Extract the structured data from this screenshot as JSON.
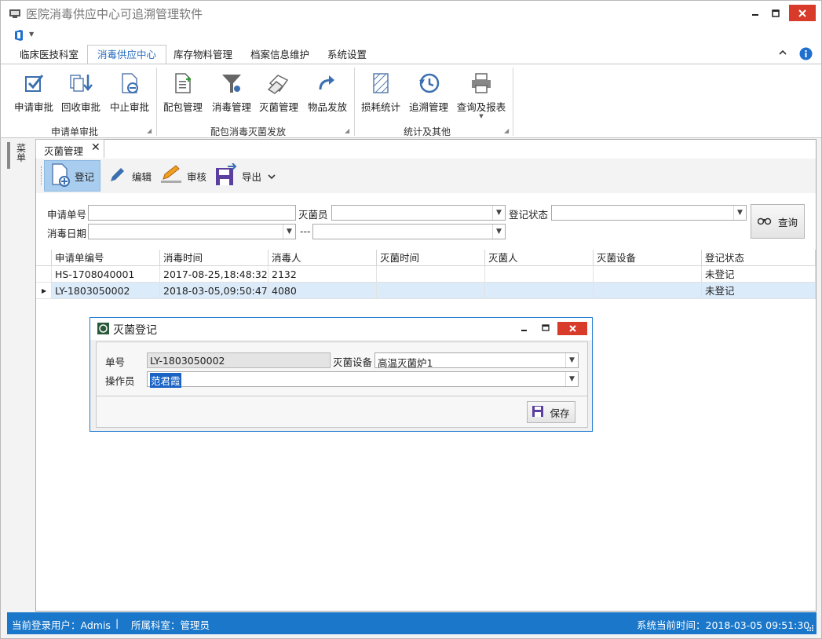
{
  "window": {
    "title": "医院消毒供应中心可追溯管理软件"
  },
  "ribbon_tabs": [
    "临床医技科室",
    "消毒供应中心",
    "库存物料管理",
    "档案信息维护",
    "系统设置"
  ],
  "ribbon_groups": [
    {
      "label": "申请单审批",
      "buttons": [
        "申请审批",
        "回收审批",
        "中止审批"
      ]
    },
    {
      "label": "配包消毒灭菌发放",
      "buttons": [
        "配包管理",
        "消毒管理",
        "灭菌管理",
        "物品发放"
      ]
    },
    {
      "label": "统计及其他",
      "buttons": [
        "损耗统计",
        "追溯管理",
        "查询及报表"
      ]
    }
  ],
  "sidebar": {
    "label": "菜单"
  },
  "doc_tab": {
    "label": "灭菌管理"
  },
  "toolbar": {
    "register": "登记",
    "edit": "编辑",
    "audit": "审核",
    "export": "导出"
  },
  "filter": {
    "request_no_label": "申请单号",
    "request_no_value": "",
    "sterilizer_label": "灭菌员",
    "sterilizer_value": "",
    "status_label": "登记状态",
    "status_value": "",
    "date_label": "消毒日期",
    "date_from": "",
    "date_sep": "---",
    "date_to": "",
    "query_button": "查询"
  },
  "grid": {
    "columns": [
      "申请单编号",
      "消毒时间",
      "消毒人",
      "灭菌时间",
      "灭菌人",
      "灭菌设备",
      "登记状态"
    ],
    "rows": [
      [
        "HS-1708040001",
        "2017-08-25,18:48:32",
        "2132",
        "",
        "",
        "",
        "未登记"
      ],
      [
        "LY-1803050002",
        "2018-03-05,09:50:47",
        "4080",
        "",
        "",
        "",
        "未登记"
      ]
    ],
    "selected_row": 1
  },
  "dialog": {
    "title": "灭菌登记",
    "order_label": "单号",
    "order_value": "LY-1803050002",
    "device_label": "灭菌设备",
    "device_value": "高温灭菌炉1",
    "operator_label": "操作员",
    "operator_value": "范君霞",
    "save_button": "保存"
  },
  "status": {
    "user": "当前登录用户：Admis",
    "sep": "|",
    "dept": "所属科室：管理员",
    "time": "系统当前时间：2018-03-05 09:51:30"
  },
  "colors": {
    "accent": "#1a77c9",
    "active_tab": "#2b6fc0",
    "close_red": "#d93b2b",
    "selected_row": "#dcebfa"
  }
}
